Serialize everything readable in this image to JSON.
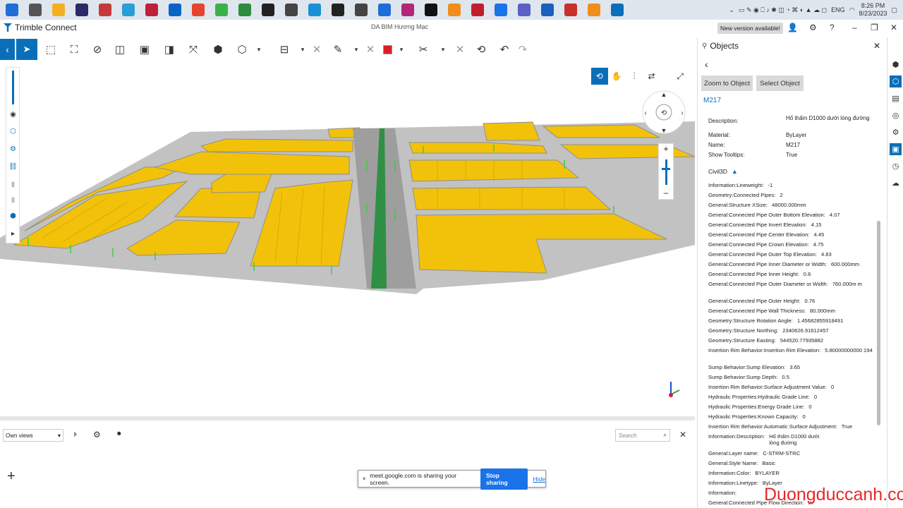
{
  "taskbar": {
    "icons": [
      {
        "name": "windows-start-icon",
        "color": "#1f6fd6"
      },
      {
        "name": "widgets-icon",
        "color": "#555"
      },
      {
        "name": "file-explorer-icon",
        "color": "#f2b01e"
      },
      {
        "name": "after-effects-icon",
        "color": "#2b2b66"
      },
      {
        "name": "app-icon",
        "color": "#c43a3a"
      },
      {
        "name": "app-icon",
        "color": "#2a9ed8"
      },
      {
        "name": "app-icon",
        "color": "#c0203a"
      },
      {
        "name": "outlook-icon",
        "color": "#0a64c8"
      },
      {
        "name": "chrome-icon",
        "color": "#e7442f"
      },
      {
        "name": "app-icon",
        "color": "#3ab14a"
      },
      {
        "name": "app-icon",
        "color": "#2d8d3c"
      },
      {
        "name": "app-icon",
        "color": "#222"
      },
      {
        "name": "app-icon",
        "color": "#444"
      },
      {
        "name": "app-icon",
        "color": "#1b8fd6"
      },
      {
        "name": "notion-icon",
        "color": "#222"
      },
      {
        "name": "file-icon",
        "color": "#444"
      },
      {
        "name": "app-icon",
        "color": "#1b6fd6"
      },
      {
        "name": "app-icon",
        "color": "#b3267a"
      },
      {
        "name": "tiktok-icon",
        "color": "#111"
      },
      {
        "name": "app-icon",
        "color": "#f08d1b"
      },
      {
        "name": "app-icon",
        "color": "#c11f2c"
      },
      {
        "name": "zalo-icon",
        "color": "#1a73e8"
      },
      {
        "name": "teams-icon",
        "color": "#5b5fc7"
      },
      {
        "name": "onenote-icon",
        "color": "#1b5fbf"
      },
      {
        "name": "app-icon",
        "color": "#c9302c"
      },
      {
        "name": "app-icon",
        "color": "#f08d1b"
      },
      {
        "name": "trimble-connect-icon",
        "color": "#0a6fb8"
      }
    ],
    "tray": {
      "lang": "ENG",
      "time": "8:26 PM",
      "date": "8/23/2023"
    }
  },
  "titlebar": {
    "app": "Trimble Connect",
    "project": "DA BIM Hương Mạc",
    "new_version": "New version available!"
  },
  "viewport": {
    "accent": "#0a6fb8",
    "parcel_color": "#f2c20a",
    "road_color": "#b9b9b9"
  },
  "bottom": {
    "views_label": "Own views",
    "search_placeholder": "Search"
  },
  "share_bar": {
    "message": "meet.google.com is sharing your screen.",
    "stop": "Stop sharing",
    "hide": "Hide"
  },
  "panel": {
    "title": "Objects",
    "zoom_btn": "Zoom to Object",
    "select_btn": "Select Object",
    "object_id": "M217",
    "group_label": "Civil3D",
    "basic_props": [
      {
        "k": "Description:",
        "v": "Hố thấm D1000 dưới lòng đường"
      },
      {
        "k": "Material:",
        "v": "ByLayer"
      },
      {
        "k": "Name:",
        "v": "M217"
      },
      {
        "k": "Show Tooltips:",
        "v": "True"
      }
    ],
    "civil_props": [
      {
        "k": "Information:Lineweight:",
        "v": "-1"
      },
      {
        "k": "Geometry:Connected Pipes:",
        "v": "2"
      },
      {
        "k": "General:Structure XSize:",
        "v": "48000.000mm"
      },
      {
        "k": "General:Connected Pipe Outer Bottom Elevation:",
        "v": "4.07"
      },
      {
        "k": "General:Connected Pipe Invert Elevation:",
        "v": "4.15"
      },
      {
        "k": "General:Connected Pipe Center Elevation:",
        "v": "4.45"
      },
      {
        "k": "General:Connected Pipe Crown Elevation:",
        "v": "4.75"
      },
      {
        "k": "General:Connected Pipe Outer Top Elevation:",
        "v": "4.83"
      },
      {
        "k": "General:Connected Pipe Inner Diameter or Width:",
        "v": "600.000mm"
      },
      {
        "k": "General:Connected Pipe Inner Height:",
        "v": "0.6"
      },
      {
        "k": "General:Connected Pipe Outer Diameter or Width:",
        "v": "760.000m m"
      },
      {
        "k": "General:Connected Pipe Outer Height:",
        "v": "0.76"
      },
      {
        "k": "General:Connected Pipe Wall Thickness:",
        "v": "80.000mm"
      },
      {
        "k": "Geometry:Structure Rotation Angle:",
        "v": "1.45682855918491"
      },
      {
        "k": "Geometry:Structure Northing:",
        "v": "2340626.91612457"
      },
      {
        "k": "Geometry:Structure Easting:",
        "v": "544520.77935882"
      },
      {
        "k": "Insertion Rim Behavior:Insertion Rim Elevation:",
        "v": "5.80000000000 194"
      },
      {
        "k": "Sump Behavior:Sump Elevation:",
        "v": "3.65"
      },
      {
        "k": "Sump Behavior:Sump Depth:",
        "v": "0.5"
      },
      {
        "k": "Insertion Rim Behavior:Surface Adjustment Value:",
        "v": "0"
      },
      {
        "k": "Hydraulic Properties:Hydraulic Grade Line:",
        "v": "0"
      },
      {
        "k": "Hydraulic Properties:Energy Grade Line:",
        "v": "0"
      },
      {
        "k": "Hydraulic Properties:Known Capacity:",
        "v": "0"
      },
      {
        "k": "Insertion Rim Behavior:Automatic Surface Adjustment:",
        "v": "True"
      },
      {
        "k": "Information:Description:",
        "v": "Hố thấm D1000 dưới lòng đường"
      },
      {
        "k": "General:Layer name:",
        "v": "C-STRM-STRC"
      },
      {
        "k": "General:Style Name:",
        "v": "Basic"
      },
      {
        "k": "Information:Color:",
        "v": "BYLAYER"
      },
      {
        "k": "Information:Linetype:",
        "v": "ByLayer"
      },
      {
        "k": "Information:",
        "v": ""
      },
      {
        "k": "General:Connected Pipe Flow Direction:",
        "v": "In"
      }
    ]
  },
  "watermark": "Duongduccanh.com"
}
